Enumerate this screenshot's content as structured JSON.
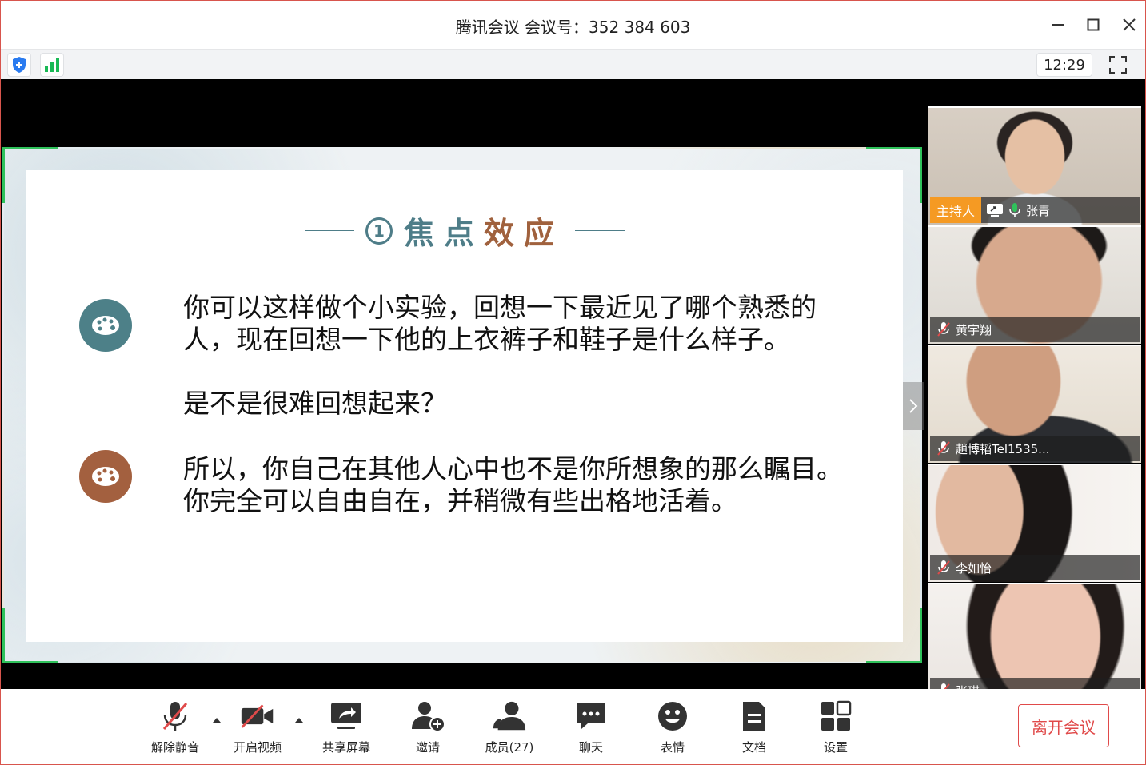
{
  "window": {
    "title": "腾讯会议 会议号：352 384 603",
    "minimize_glyph": "—",
    "maximize_glyph": "☐",
    "close_glyph": "✕"
  },
  "statusbar": {
    "clock": "12:29",
    "icons": [
      "shield-icon",
      "signal-icon",
      "fullscreen-icon"
    ]
  },
  "slide": {
    "number": "1",
    "heading_a": "焦点",
    "heading_b": "效应",
    "paragraph1_line1": "你可以这样做个小实验，回想一下最近见了哪个熟悉的",
    "paragraph1_line2": "人，现在回想一下他的上衣裤子和鞋子是什么样子。",
    "paragraph2": "是不是很难回想起来？",
    "paragraph3_line1": "所以，你自己在其他人心中也不是你所想象的那么瞩目。",
    "paragraph3_line2": "你完全可以自由自在，并稍微有些出格地活着。",
    "colors": {
      "teal": "#4e7d88",
      "brown": "#a0613d"
    }
  },
  "participants": [
    {
      "name": "张青",
      "host_label": "主持人",
      "muted": false,
      "sharing": true
    },
    {
      "name": "黄宇翔",
      "muted": true
    },
    {
      "name": "趙博韬Tel1535...",
      "muted": true
    },
    {
      "name": "李如怡",
      "muted": true
    },
    {
      "name": "张琪",
      "muted": true
    }
  ],
  "toolbar": {
    "unmute": "解除静音",
    "start_video": "开启视频",
    "share_screen": "共享屏幕",
    "invite": "邀请",
    "members": "成员(27)",
    "chat": "聊天",
    "reactions": "表情",
    "docs": "文档",
    "settings": "设置",
    "leave": "离开会议"
  },
  "colors": {
    "accent_green": "#2fc25b",
    "leave_red": "#e04a4a",
    "host_orange": "#f59a23"
  }
}
